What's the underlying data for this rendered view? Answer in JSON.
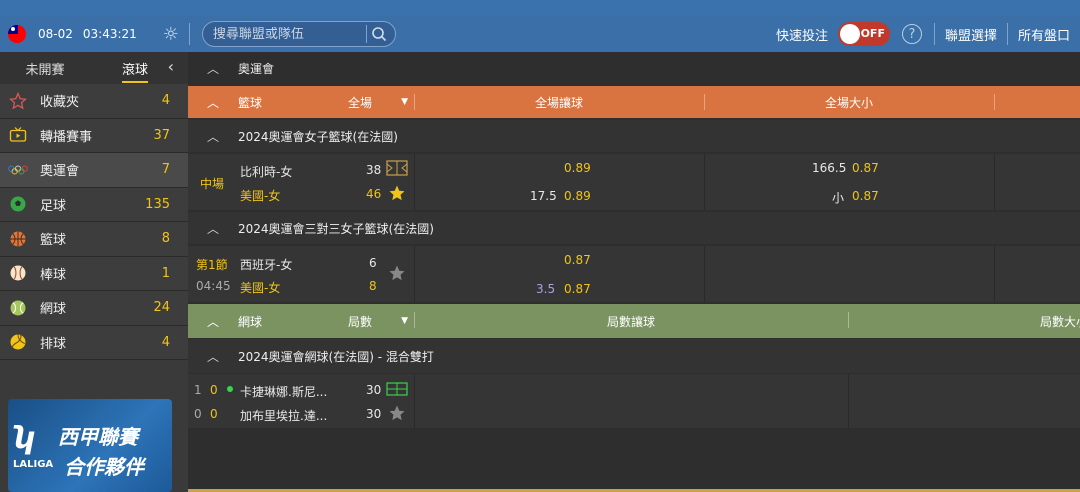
{
  "header": {
    "date": "08-02",
    "time": "03:43:21",
    "search_placeholder": "搜尋聯盟或隊伍",
    "quick_bet": "快速投注",
    "toggle_state": "OFF",
    "help": "?",
    "league_select": "聯盟選擇",
    "all_markets": "所有盤口"
  },
  "sidebar": {
    "tabs": [
      "未開賽",
      "滾球"
    ],
    "active_tab": "滾球",
    "items": [
      {
        "label": "收藏夾",
        "count": "4",
        "icon": "star-icon"
      },
      {
        "label": "轉播賽事",
        "count": "37",
        "icon": "tv-icon"
      },
      {
        "label": "奧運會",
        "count": "7",
        "icon": "olympic-rings-icon"
      },
      {
        "label": "足球",
        "count": "135",
        "icon": "soccer-ball-icon"
      },
      {
        "label": "籃球",
        "count": "8",
        "icon": "basketball-icon"
      },
      {
        "label": "棒球",
        "count": "1",
        "icon": "baseball-icon"
      },
      {
        "label": "網球",
        "count": "24",
        "icon": "tennis-ball-icon"
      },
      {
        "label": "排球",
        "count": "4",
        "icon": "volleyball-icon"
      }
    ],
    "banner": {
      "logo": "LALIGA",
      "line1": "西甲聯賽",
      "line2": "合作夥伴"
    }
  },
  "main": {
    "olympics_title": "奧運會",
    "basketball": {
      "sport": "籃球",
      "type": "全場",
      "col1": "全場讓球",
      "col2": "全場大小",
      "color": "#d9733f"
    },
    "bb_league1": "2024奧運會女子籃球(在法國)",
    "match1": {
      "status": "中場",
      "team1": "比利時-女",
      "score1": "38",
      "team2": "美國-女",
      "score2": "46",
      "hdp_odds1": "0.89",
      "hdp_line2": "17.5",
      "hdp_odds2": "0.89",
      "ou_line1": "166.5",
      "ou_odds1": "0.87",
      "ou_label2": "小",
      "ou_odds2": "0.87"
    },
    "bb_league2": "2024奧運會三對三女子籃球(在法國)",
    "match2": {
      "period": "第1節",
      "clock": "04:45",
      "team1": "西班牙-女",
      "score1": "6",
      "team2": "美國-女",
      "score2": "8",
      "hdp_odds1": "0.87",
      "hdp_line2": "3.5",
      "hdp_odds2": "0.87"
    },
    "tennis": {
      "sport": "網球",
      "type": "局數",
      "col1": "局數讓球",
      "col2": "局數大小",
      "color": "#7a9361"
    },
    "tn_league1": "2024奧運會網球(在法國) - 混合雙打",
    "match3": {
      "p1_sets": "1",
      "p1_games": "0",
      "p1": "卡捷琳娜.斯尼...",
      "p1_points": "30",
      "p2_sets": "0",
      "p2_games": "0",
      "p2": "加布里埃拉.達...",
      "p2_points": "30"
    }
  }
}
